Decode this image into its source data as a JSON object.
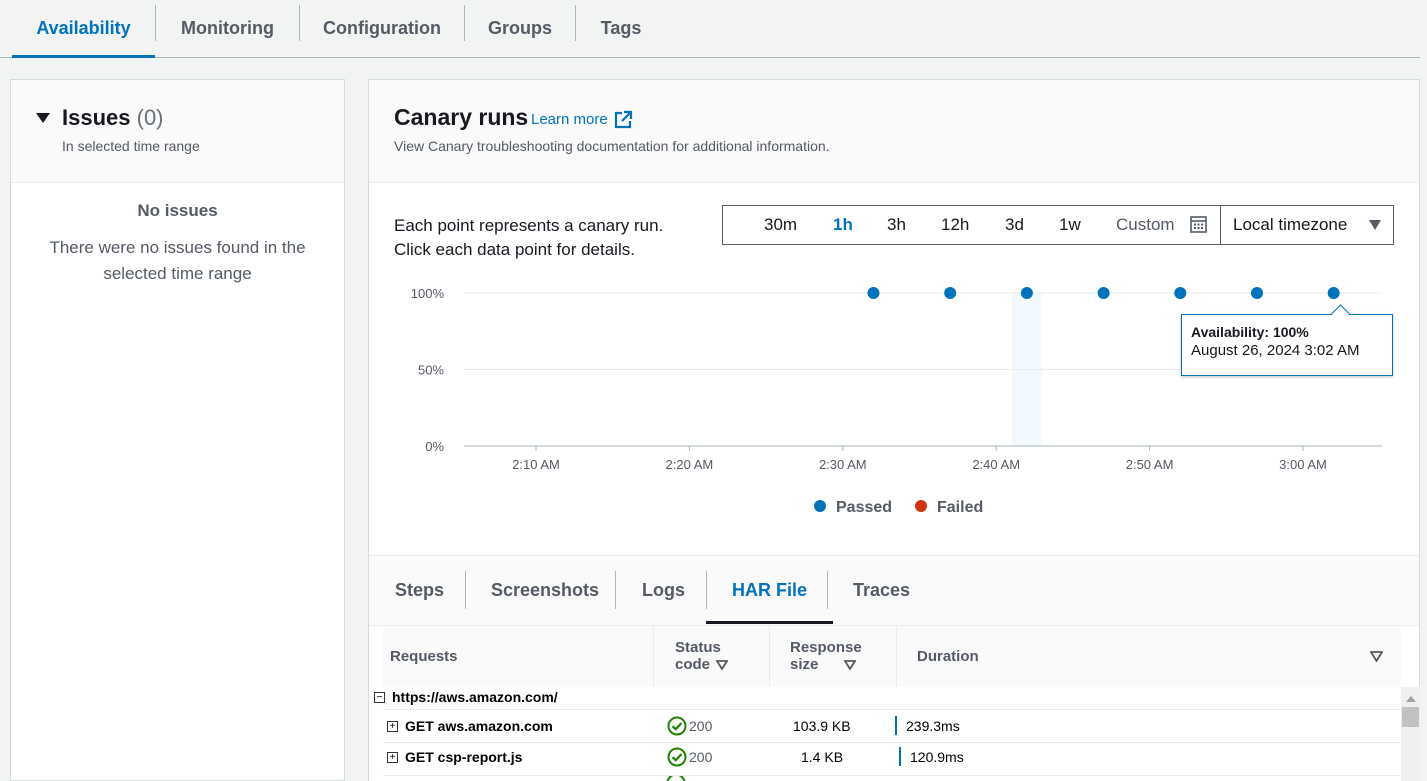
{
  "top_tabs": [
    {
      "label": "Availability",
      "active": true
    },
    {
      "label": "Monitoring"
    },
    {
      "label": "Configuration"
    },
    {
      "label": "Groups"
    },
    {
      "label": "Tags"
    }
  ],
  "issues": {
    "title": "Issues",
    "count": "(0)",
    "subtitle": "In selected time range",
    "empty_title": "No issues",
    "empty_desc_line1": "There were no issues found in the",
    "empty_desc_line2": "selected time range"
  },
  "canary": {
    "title": "Canary runs",
    "learn_more": "Learn more",
    "subtitle": "View Canary troubleshooting documentation for additional information.",
    "hint_line1": "Each point represents a canary run.",
    "hint_line2": "Click each data point for details.",
    "ranges": [
      "30m",
      "1h",
      "3h",
      "12h",
      "3d",
      "1w"
    ],
    "active_range": "1h",
    "custom_label": "Custom",
    "timezone": "Local timezone"
  },
  "tooltip": {
    "line1": "Availability: 100%",
    "line2": "August 26, 2024 3:02 AM"
  },
  "chart_data": {
    "type": "scatter",
    "title": "",
    "xlabel": "",
    "ylabel": "",
    "x_ticks": [
      "2:10 AM",
      "2:20 AM",
      "2:30 AM",
      "2:40 AM",
      "2:50 AM",
      "3:00 AM"
    ],
    "y_ticks": [
      "0%",
      "50%",
      "100%"
    ],
    "ylim": [
      0,
      100
    ],
    "series": [
      {
        "name": "Passed",
        "color": "#0073bb",
        "points": [
          {
            "x": "2:32 AM",
            "y": 100
          },
          {
            "x": "2:37 AM",
            "y": 100
          },
          {
            "x": "2:42 AM",
            "y": 100
          },
          {
            "x": "2:47 AM",
            "y": 100
          },
          {
            "x": "2:52 AM",
            "y": 100
          },
          {
            "x": "2:57 AM",
            "y": 100
          },
          {
            "x": "3:02 AM",
            "y": 100
          }
        ]
      },
      {
        "name": "Failed",
        "color": "#d13212",
        "points": []
      }
    ],
    "highlight_x": "2:42 AM",
    "grid": true,
    "legend_position": "bottom"
  },
  "lower_tabs": [
    {
      "label": "Steps"
    },
    {
      "label": "Screenshots"
    },
    {
      "label": "Logs"
    },
    {
      "label": "HAR File",
      "active": true
    },
    {
      "label": "Traces"
    }
  ],
  "har": {
    "columns": {
      "requests": "Requests",
      "status_line1": "Status",
      "status_line2": "code",
      "size_line1": "Response",
      "size_line2": "size",
      "duration": "Duration"
    },
    "page_url": "https://aws.amazon.com/",
    "rows": [
      {
        "request": "GET aws.amazon.com",
        "status": "200",
        "size": "103.9 KB",
        "duration": "239.3ms"
      },
      {
        "request": "GET csp-report.js",
        "status": "200",
        "size": "1.4 KB",
        "duration": "120.9ms"
      }
    ]
  }
}
